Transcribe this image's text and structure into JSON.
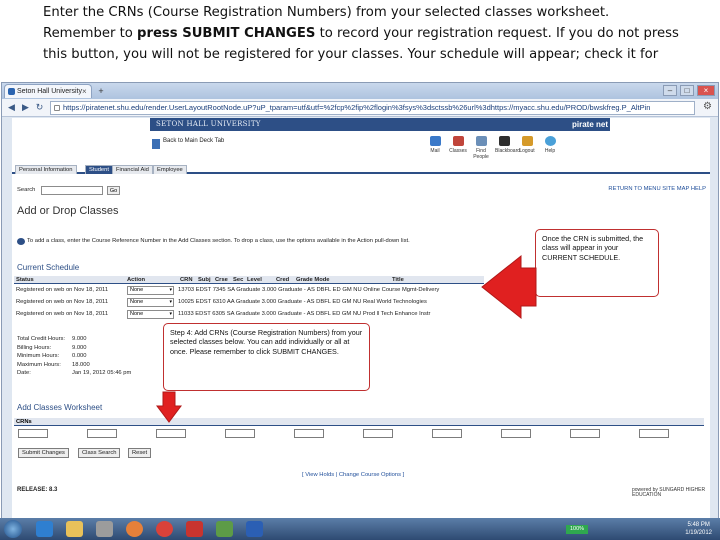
{
  "caption": {
    "line1": "Enter the CRNs (Course Registration Numbers) from your selected classes worksheet.",
    "line2_pre": "Remember to ",
    "line2_bold": "press SUBMIT CHANGES",
    "line2_post": " to record your registration request. If you do not press",
    "line3": "this button, you will not be registered for your classes. Your schedule will appear; check it for"
  },
  "browser": {
    "tab_title": "Seton Hall University",
    "new_tab": "+",
    "address": "https://piratenet.shu.edu/render.UserLayoutRootNode.uP?uP_tparam=utf&utf=%2fcp%2fip%2flogin%3fsys%3dsctssb%26url%3dhttps://myacc.shu.edu/PROD/bwskfreg.P_AltPin"
  },
  "portal": {
    "university": "SETON HALL UNIVERSITY",
    "brand": "pirate net",
    "back_link": "Back to Main Deck Tab",
    "tools": [
      "Mail",
      "Classes",
      "Find People",
      "Blackboard",
      "Logout",
      "Help"
    ]
  },
  "nav_tabs": [
    "Personal Information",
    "Student",
    "Financial Aid",
    "Employee"
  ],
  "search_label": "Search",
  "go_label": "Go",
  "top_links": "RETURN TO MENU   SITE MAP   HELP",
  "page_title": "Add or Drop Classes",
  "info_text": "To add a class, enter the Course Reference Number in the Add Classes section. To drop a class, use the options available in the Action pull-down list.",
  "current_schedule": {
    "title": "Current Schedule",
    "headers": [
      "Status",
      "Action",
      "CRN",
      "Subj",
      "Crse",
      "Sec",
      "Level",
      "Cred",
      "Grade Mode",
      "Title"
    ],
    "rows": [
      {
        "status": "Registered on web on Nov 18, 2011",
        "action": "None",
        "course": "13703 EDST 7345 SA  Graduate 3.000 Graduate - AS DBFL ED GM NU Online Course Mgmt-Delivery"
      },
      {
        "status": "Registered on web on Nov 18, 2011",
        "action": "None",
        "course": "10025 EDST 6310 AA  Graduate 3.000 Graduate - AS DBFL ED GM NU Real World Technologies"
      },
      {
        "status": "Registered on web on Nov 18, 2011",
        "action": "None",
        "course": "11033 EDST 6305 SA  Graduate 3.000 Graduate - AS DBFL ED GM NU Prod ll Tech Enhance Instr"
      }
    ]
  },
  "totals": {
    "labels": [
      "Total Credit Hours:",
      "Billing Hours:",
      "Minimum Hours:",
      "Maximum Hours:",
      "Date:"
    ],
    "values": [
      "9.000",
      "9.000",
      "0.000",
      "18.000",
      "Jan 19, 2012 05:46 pm"
    ]
  },
  "add_classes": {
    "title": "Add Classes Worksheet",
    "crns_label": "CRNs"
  },
  "buttons": {
    "submit": "Submit Changes",
    "class_search": "Class Search",
    "reset": "Reset"
  },
  "footer_links": "[ View Holds | Change Course Options ]",
  "release": "RELEASE: 8.3",
  "powered_by": "powered by SUNGARD HIGHER EDUCATION",
  "callouts": {
    "crn_note": "Once the CRN is submitted, the class will appear in your CURRENT SCHEDULE.",
    "step4": "Step 4: Add CRNs (Course Registration Numbers) from your selected classes below. You can add individually or all at once. Please remember to click SUBMIT CHANGES."
  },
  "taskbar": {
    "battery": "100%",
    "time": "5:48 PM",
    "date": "1/19/2012"
  },
  "colors": {
    "banner_blue": "#2d4f86",
    "arrow_red": "#e02020",
    "callout_border": "#c03030"
  }
}
